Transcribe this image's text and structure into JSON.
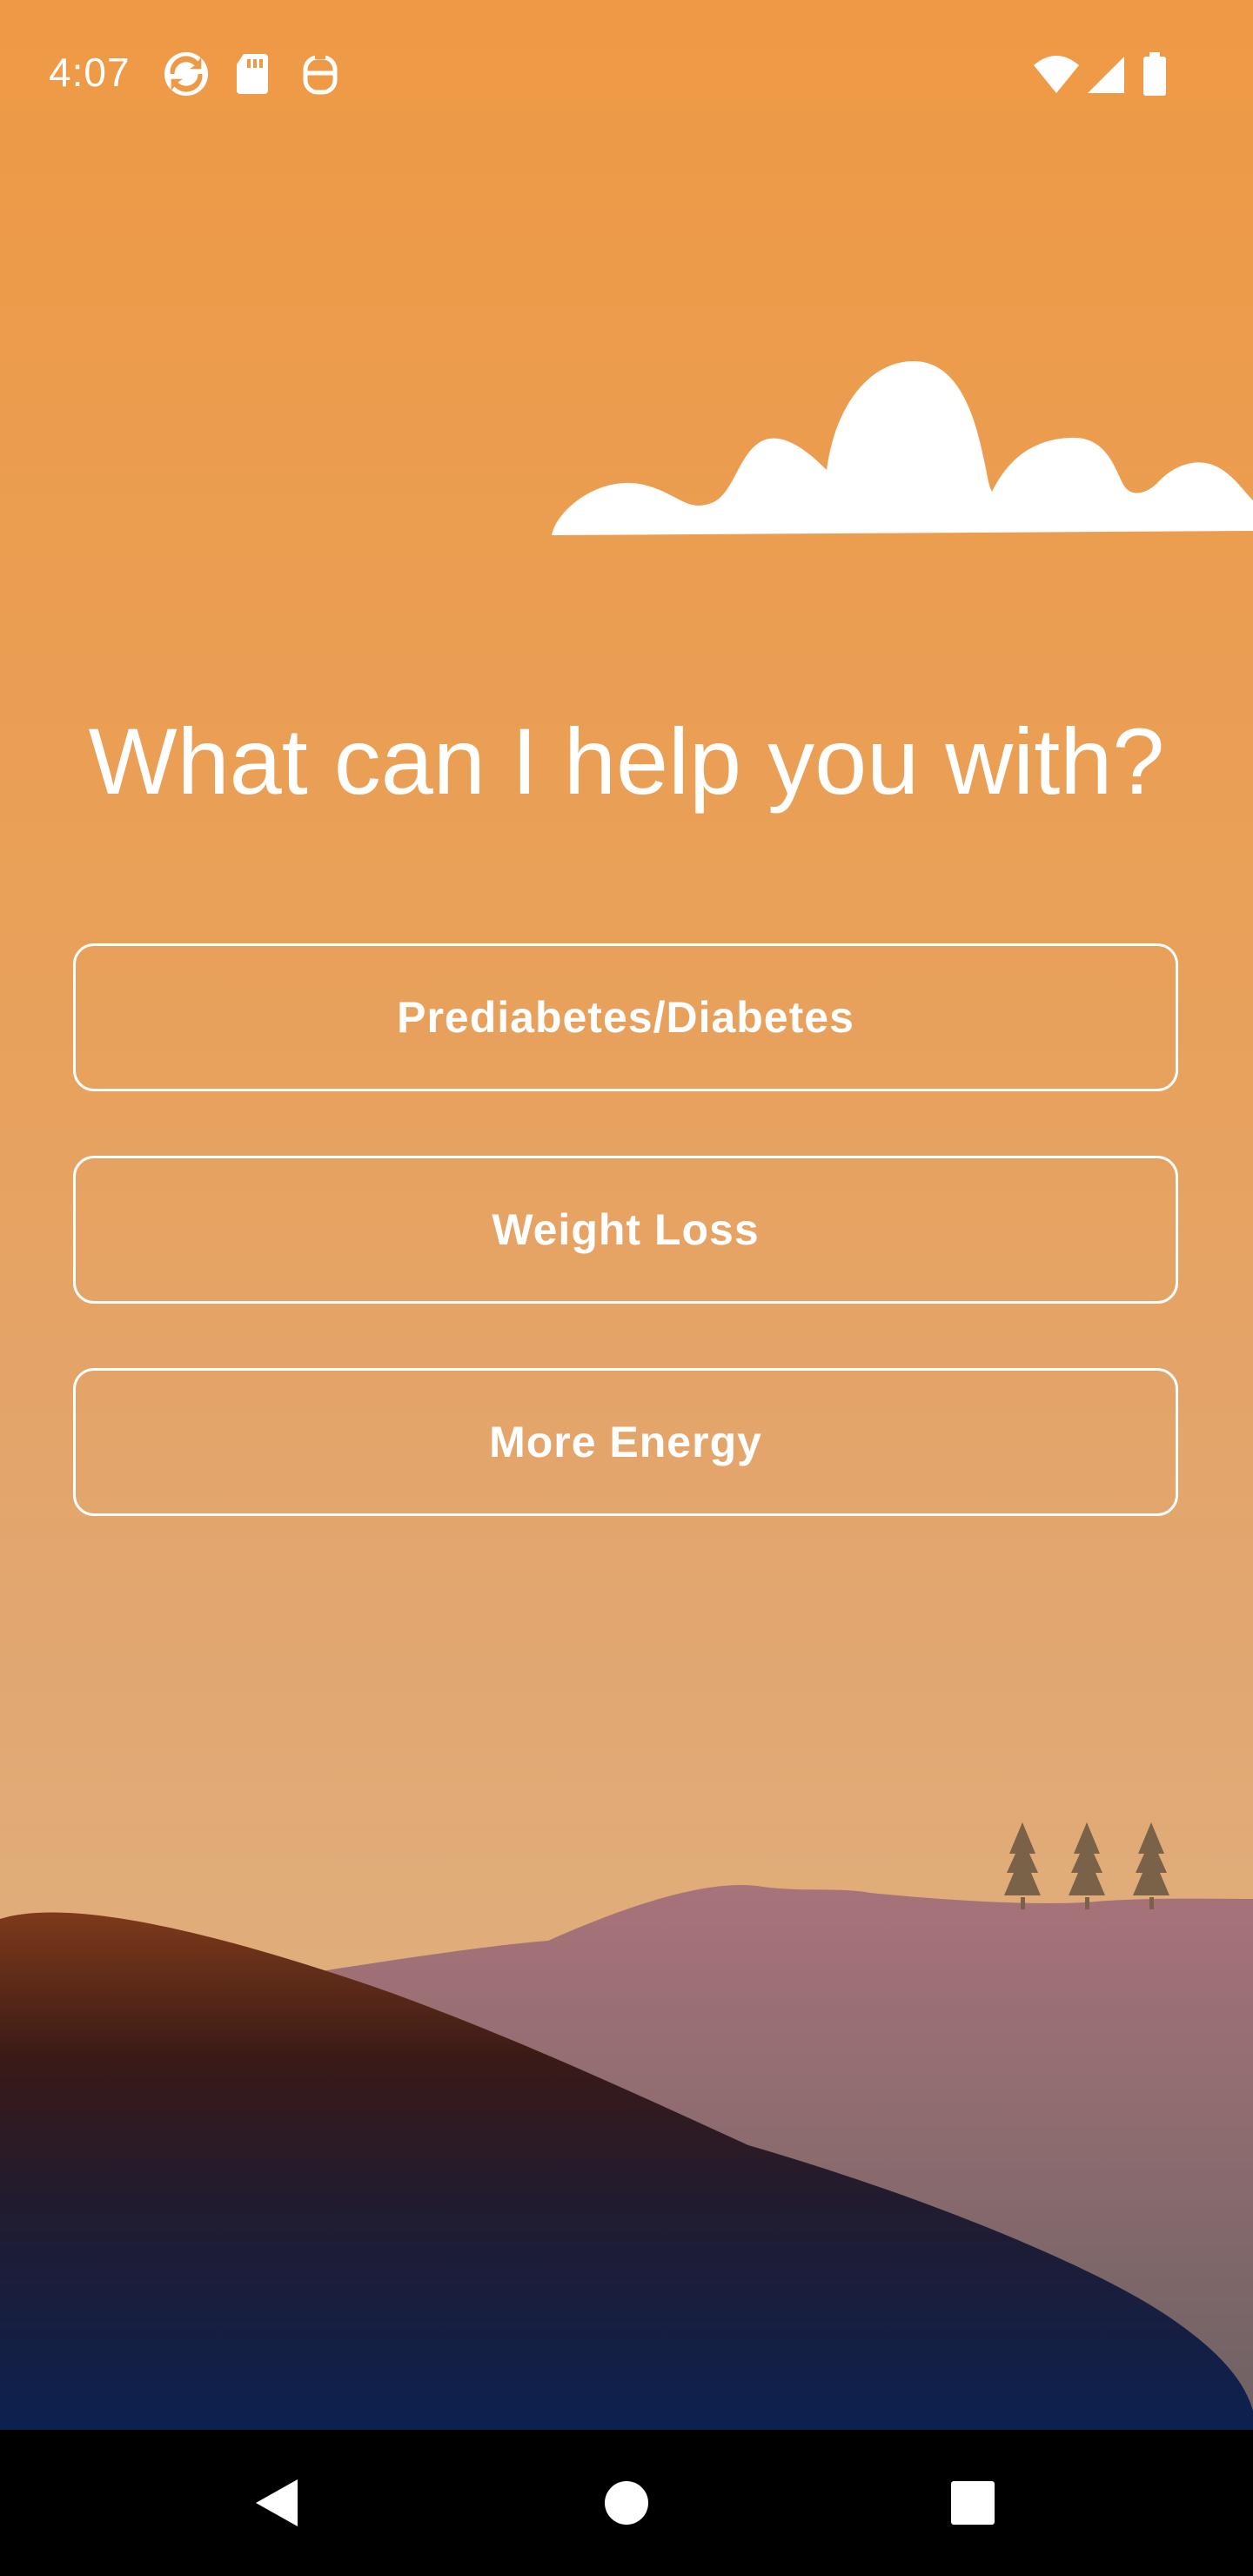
{
  "status_bar": {
    "time": "4:07",
    "left_icons": [
      "sync-app-icon",
      "sd-card-icon",
      "app-notification-icon"
    ],
    "right_icons": [
      "wifi-icon",
      "cell-signal-icon",
      "battery-icon"
    ]
  },
  "main": {
    "headline": "What can I help you with?",
    "options": [
      {
        "label": "Prediabetes/Diabetes"
      },
      {
        "label": "Weight Loss"
      },
      {
        "label": "More Energy"
      }
    ]
  },
  "illustration": {
    "elements": [
      "cloud",
      "tree",
      "tree",
      "tree",
      "hills"
    ]
  },
  "nav_bar": {
    "buttons": [
      "back-icon",
      "home-icon",
      "recents-icon"
    ]
  },
  "colors": {
    "background_top": "#EE9945",
    "background_bottom": "#E1B383",
    "text": "#FFFFFF",
    "nav_bar": "#000000"
  }
}
